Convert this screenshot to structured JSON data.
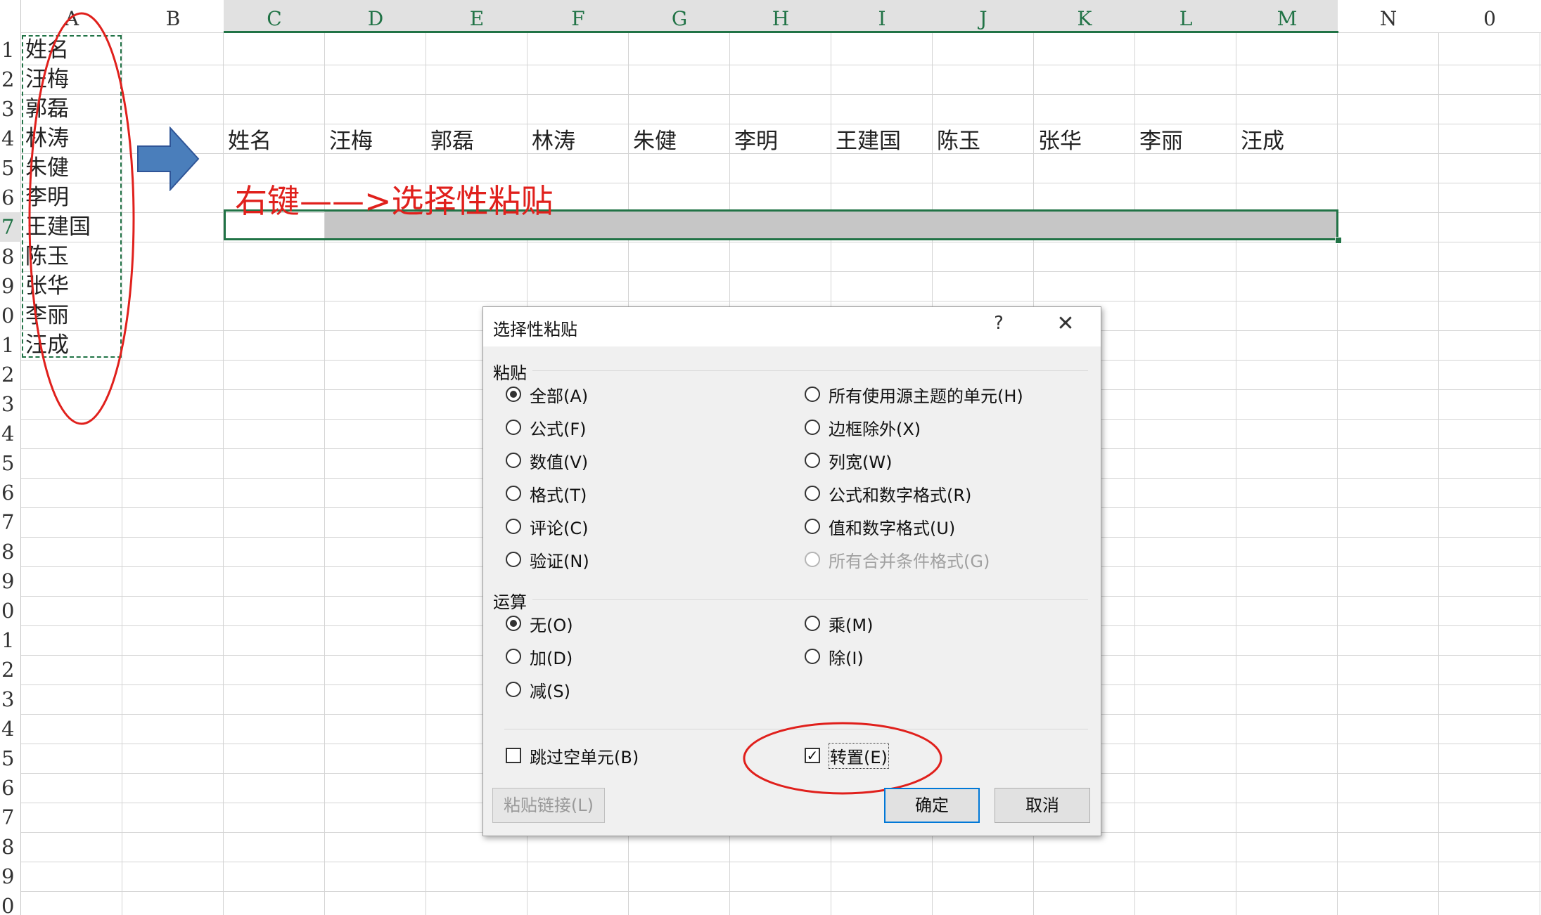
{
  "colors": {
    "accent": "#217346",
    "annotation": "#e0201c",
    "arrow": "#4a7ebb",
    "dialog_default_button": "#0078d7"
  },
  "spreadsheet": {
    "columns": [
      "A",
      "B",
      "C",
      "D",
      "E",
      "F",
      "G",
      "H",
      "I",
      "J",
      "K",
      "L",
      "M",
      "N",
      "0"
    ],
    "rows": [
      "1",
      "2",
      "3",
      "4",
      "5",
      "6",
      "7",
      "8",
      "9",
      "0",
      "1",
      "2",
      "3",
      "4",
      "5",
      "6",
      "7",
      "8",
      "9",
      "0",
      "1",
      "2",
      "3",
      "4",
      "5",
      "6",
      "7",
      "8",
      "9",
      "0"
    ],
    "column_a_values": [
      "姓名",
      "汪梅",
      "郭磊",
      "林涛",
      "朱健",
      "李明",
      "王建国",
      "陈玉",
      "张华",
      "李丽",
      "汪成"
    ],
    "row4_values": [
      "姓名",
      "汪梅",
      "郭磊",
      "林涛",
      "朱健",
      "李明",
      "王建国",
      "陈玉",
      "张华",
      "李丽",
      "汪成"
    ]
  },
  "annotations": {
    "instruction": "右键——>选择性粘贴",
    "arrow_icon": "right-arrow-icon"
  },
  "dialog": {
    "title": "选择性粘贴",
    "help": "?",
    "close": "✕",
    "paste_group": "粘贴",
    "paste_options_left": [
      "全部(A)",
      "公式(F)",
      "数值(V)",
      "格式(T)",
      "评论(C)",
      "验证(N)"
    ],
    "paste_options_right": [
      "所有使用源主题的单元(H)",
      "边框除外(X)",
      "列宽(W)",
      "公式和数字格式(R)",
      "值和数字格式(U)",
      "所有合并条件格式(G)"
    ],
    "operation_group": "运算",
    "operation_options_left": [
      "无(O)",
      "加(D)",
      "减(S)"
    ],
    "operation_options_right": [
      "乘(M)",
      "除(I)"
    ],
    "skip_blanks": "跳过空单元(B)",
    "transpose": "转置(E)",
    "paste_link_button": "粘贴链接(L)",
    "ok_button": "确定",
    "cancel_button": "取消"
  }
}
